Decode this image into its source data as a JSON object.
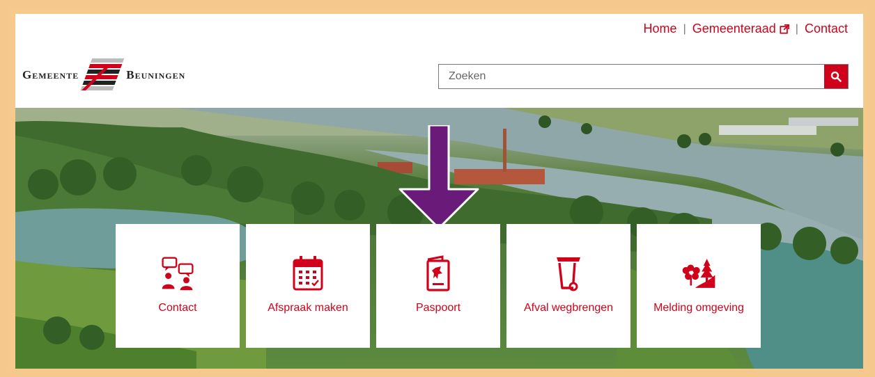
{
  "header": {
    "nav": [
      {
        "label": "Home"
      },
      {
        "label": "Gemeenteraad"
      },
      {
        "label": "Contact"
      }
    ],
    "logo": {
      "left_word": "Gemeente",
      "right_word": "Beuningen"
    },
    "search": {
      "placeholder": "Zoeken"
    }
  },
  "tiles": [
    {
      "label": "Contact",
      "icon": "chat-people-icon"
    },
    {
      "label": "Afspraak maken",
      "icon": "calendar-icon"
    },
    {
      "label": "Paspoort",
      "icon": "passport-icon"
    },
    {
      "label": "Afval wegbrengen",
      "icon": "waste-bin-icon"
    },
    {
      "label": "Melding omgeving",
      "icon": "flower-tree-icon"
    }
  ],
  "colors": {
    "accent": "#d0021b",
    "frame": "#f5c98d",
    "arrow": "#6a1b7a"
  }
}
